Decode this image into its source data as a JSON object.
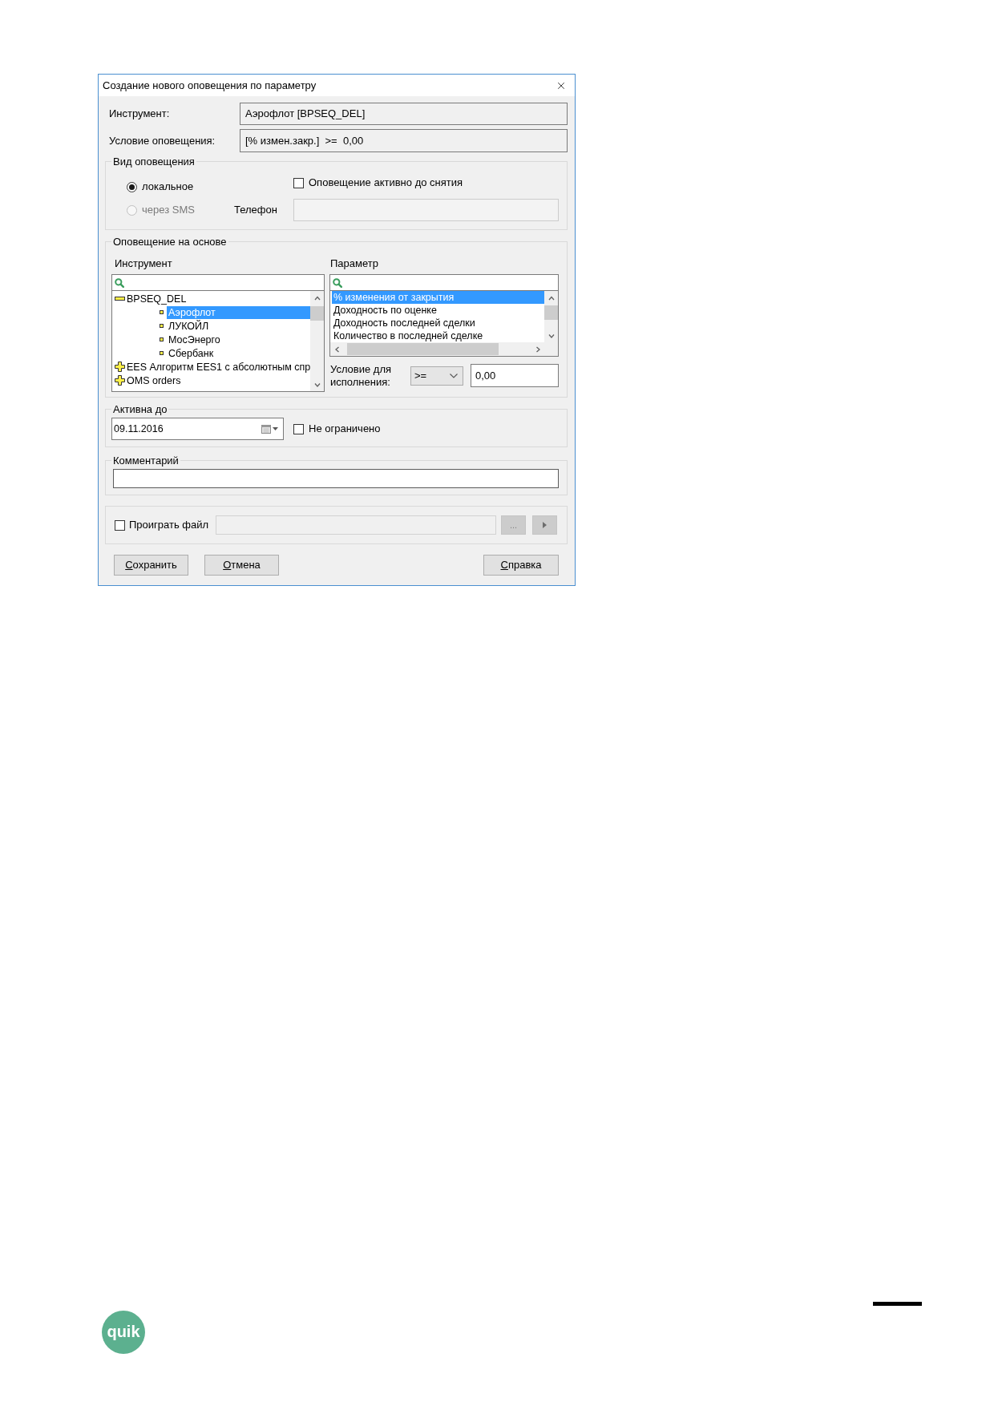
{
  "window": {
    "title": "Создание нового оповещения по параметру"
  },
  "summary": [
    {
      "label": "Инструмент:",
      "value": "Аэрофлот [BPSEQ_DEL]"
    },
    {
      "label": "Условие оповещения:",
      "value": "[% измен.закр.]  >=  0,00"
    }
  ],
  "notification_type": {
    "legend": "Вид оповещения",
    "options": [
      {
        "label": "локальное",
        "selected": true,
        "disabled": false
      },
      {
        "label": "через SMS",
        "selected": false,
        "disabled": true
      }
    ],
    "active_until_removed": {
      "label": "Оповещение активно до снятия",
      "checked": false
    },
    "phone": {
      "label": "Телефон",
      "disabled": true
    }
  },
  "based_on": {
    "legend": "Оповещение на основе",
    "instrument": {
      "label": "Инструмент",
      "tree": [
        {
          "label": "BPSEQ_DEL",
          "expanded": true,
          "selected": false,
          "children": [
            {
              "label": "Аэрофлот",
              "selected": true
            },
            {
              "label": "ЛУКОЙЛ",
              "selected": false
            },
            {
              "label": "МосЭнерго",
              "selected": false
            },
            {
              "label": "Сбербанк",
              "selected": false
            }
          ]
        },
        {
          "label": "EES Алгоритм EES1 с абсолютным спр",
          "expanded": false,
          "selected": false
        },
        {
          "label": "OMS orders",
          "expanded": false,
          "selected": false
        }
      ]
    },
    "parameter": {
      "label": "Параметр",
      "items": [
        {
          "label": "% изменения от закрытия",
          "selected": true
        },
        {
          "label": "Доходность по оценке",
          "selected": false
        },
        {
          "label": "Доходность последней сделки",
          "selected": false
        },
        {
          "label": "Количество в последней сделке",
          "selected": false
        }
      ]
    },
    "condition": {
      "label": "Условие для исполнения:",
      "operator": ">=",
      "value": "0,00"
    }
  },
  "active_until": {
    "legend": "Активна до",
    "date": "09.11.2016",
    "unlimited": {
      "label": "Не ограничено",
      "checked": false
    }
  },
  "comment": {
    "legend": "Комментарий"
  },
  "play_file": {
    "label": "Проиграть файл",
    "checked": false,
    "file_field": {
      "disabled": true
    },
    "browse_button": {
      "label": "...",
      "disabled": true
    },
    "play_button": {
      "disabled": true
    }
  },
  "buttons": [
    {
      "label": "Сохранить",
      "mnemonic": true
    },
    {
      "label": "Отмена",
      "mnemonic": true
    }
  ],
  "help_button": {
    "label": "Справка",
    "mnemonic": true
  },
  "logo": {
    "text": "quik"
  }
}
